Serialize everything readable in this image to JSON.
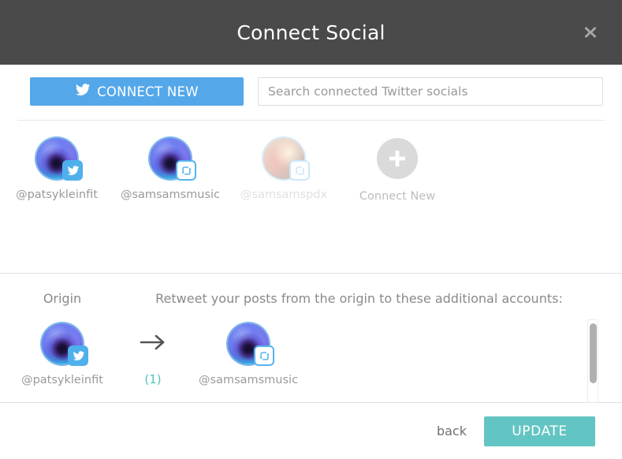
{
  "header": {
    "title": "Connect Social",
    "close_icon": "close-icon"
  },
  "toolbar": {
    "connect_new_label": "CONNECT NEW",
    "connect_new_icon": "twitter-bird-icon",
    "search_placeholder": "Search connected Twitter socials",
    "search_value": ""
  },
  "accounts": [
    {
      "handle": "@patsykleinfit",
      "badge": "twitter-bird-icon",
      "avatar": "nebula",
      "dimmed": false
    },
    {
      "handle": "@samsamsmusic",
      "badge": "retweet-icon",
      "avatar": "nebula",
      "dimmed": false
    },
    {
      "handle": "@samsamspdx",
      "badge": "retweet-icon",
      "avatar": "photo",
      "dimmed": true
    }
  ],
  "connect_new_tile": {
    "label": "Connect New",
    "icon": "plus-icon"
  },
  "mapping": {
    "origin_header": "Origin",
    "targets_header": "Retweet your posts from the origin to these additional accounts:",
    "rows": [
      {
        "origin": {
          "handle": "@patsykleinfit",
          "badge": "twitter-bird-icon",
          "avatar": "nebula"
        },
        "arrow_icon": "arrow-right-icon",
        "count": "(1)",
        "targets": [
          {
            "handle": "@samsamsmusic",
            "badge": "retweet-icon",
            "avatar": "nebula"
          }
        ]
      }
    ]
  },
  "footer": {
    "back_label": "back",
    "update_label": "UPDATE"
  },
  "colors": {
    "header_bg": "#4a4a4a",
    "connect_new_blue": "#54a8ea",
    "twitter_blue": "#4fb0ec",
    "teal_accent": "#63c5c3",
    "count_teal": "#4fc1bb"
  }
}
